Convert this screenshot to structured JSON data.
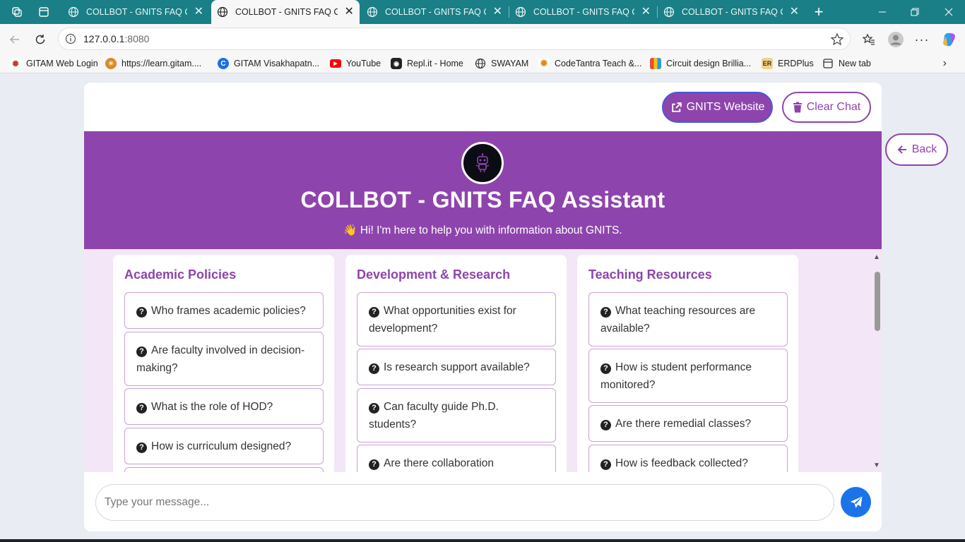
{
  "browser": {
    "tabs": [
      {
        "title": "COLLBOT - GNITS FAQ Chat",
        "active": false
      },
      {
        "title": "COLLBOT - GNITS FAQ Chat",
        "active": true
      },
      {
        "title": "COLLBOT - GNITS FAQ Chat",
        "active": false
      },
      {
        "title": "COLLBOT - GNITS FAQ Chat",
        "active": false
      },
      {
        "title": "COLLBOT - GNITS FAQ Chat",
        "active": false
      }
    ],
    "address": {
      "host": "127.0.0.1",
      "port": ":8080"
    },
    "bookmarks": [
      {
        "label": "GITAM Web Login",
        "icon": "gitam-icon"
      },
      {
        "label": "https://learn.gitam....",
        "icon": "learn-icon"
      },
      {
        "label": "GITAM Visakhapatn...",
        "icon": "c-icon"
      },
      {
        "label": "YouTube",
        "icon": "youtube-icon"
      },
      {
        "label": "Repl.it - Home",
        "icon": "replit-icon"
      },
      {
        "label": "SWAYAM",
        "icon": "globe-icon"
      },
      {
        "label": "CodeTantra Teach &...",
        "icon": "codetantra-icon"
      },
      {
        "label": "Circuit design Brillia...",
        "icon": "circuit-icon"
      },
      {
        "label": "ERDPlus",
        "icon": "er-icon"
      },
      {
        "label": "New tab",
        "icon": "newtab-icon"
      }
    ]
  },
  "page": {
    "top_buttons": {
      "website": "GNITS Website",
      "clear": "Clear Chat"
    },
    "back": "Back",
    "header": {
      "title": "COLLBOT - GNITS FAQ Assistant",
      "subtitle": "👋 Hi! I'm here to help you with information about GNITS."
    },
    "categories": [
      {
        "title": "Academic Policies",
        "questions": [
          "Who frames academic policies?",
          "Are faculty involved in decision-making?",
          "What is the role of HOD?",
          "How is curriculum designed?"
        ]
      },
      {
        "title": "Development & Research",
        "questions": [
          "What opportunities exist for development?",
          "Is research support available?",
          "Can faculty guide Ph.D. students?",
          "Are there collaboration"
        ]
      },
      {
        "title": "Teaching Resources",
        "questions": [
          "What teaching resources are available?",
          "How is student performance monitored?",
          "Are there remedial classes?",
          "How is feedback collected?"
        ]
      }
    ],
    "input": {
      "placeholder": "Type your message..."
    },
    "colors": {
      "accent": "#8e44ad",
      "send": "#1a73e8",
      "content_bg": "#f3e6f6"
    }
  }
}
